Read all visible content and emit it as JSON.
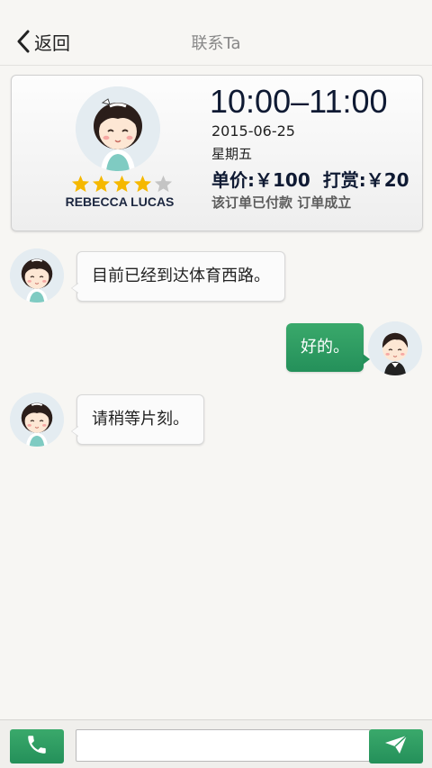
{
  "header": {
    "back_label": "返回",
    "title": "联系Ta"
  },
  "order": {
    "provider_name": "REBECCA LUCAS",
    "rating": 4,
    "rating_max": 5,
    "time_range": "10:00–11:00",
    "date": "2015-06-25",
    "weekday": "星期五",
    "unit_price": "单价:￥100",
    "tip": "打赏:￥20",
    "status": "该订单已付款 订单成立"
  },
  "messages": [
    {
      "direction": "in",
      "text": "目前已经到达体育西路。",
      "avatar": "girl-avatar"
    },
    {
      "direction": "out",
      "text": "好的。",
      "avatar": "boy-avatar"
    },
    {
      "direction": "in",
      "text": "请稍等片刻。",
      "avatar": "girl-avatar"
    }
  ],
  "composer": {
    "input_value": "",
    "placeholder": ""
  },
  "colors": {
    "accent_green": "#2a9a61",
    "star_gold": "#f5b800",
    "star_gray": "#c4c4c4"
  }
}
